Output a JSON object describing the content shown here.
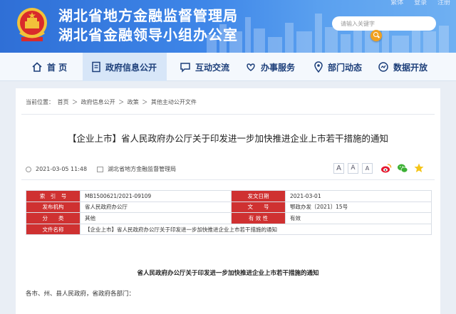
{
  "header": {
    "title_line1": "湖北省地方金融监督管理局",
    "title_line2": "湖北省金融领导小组办公室",
    "top_links": [
      "繁体",
      "登录",
      "注册"
    ],
    "search_placeholder": "请输入关键字"
  },
  "nav": {
    "items": [
      {
        "label": "首 页",
        "icon": "home-icon"
      },
      {
        "label": "政府信息公开",
        "icon": "document-icon"
      },
      {
        "label": "互动交流",
        "icon": "chat-icon"
      },
      {
        "label": "办事服务",
        "icon": "heart-hands-icon"
      },
      {
        "label": "部门动态",
        "icon": "pin-icon"
      },
      {
        "label": "数据开放",
        "icon": "data-icon"
      }
    ],
    "active_index": 1
  },
  "breadcrumb": {
    "prefix": "当前位置：",
    "items": [
      "首页",
      "政府信息公开",
      "政策",
      "其他主动公开文件"
    ],
    "separator": "＞"
  },
  "article": {
    "title": "【企业上市】省人民政府办公厅关于印发进一步加快推进企业上市若干措施的通知",
    "date": "2021-03-05 11:48",
    "source": "湖北省地方金融监督管理局",
    "font_sizes": [
      "A",
      "A",
      "A"
    ],
    "share_icons": [
      "weibo-icon",
      "wechat-icon",
      "favorite-icon"
    ]
  },
  "info_table": {
    "rows": [
      {
        "label1": "索　引　号",
        "value1": "MB1500621/2021-09109",
        "label2": "发文日期",
        "value2": "2021-03-01"
      },
      {
        "label1": "发布机构",
        "value1": "省人民政府办公厅",
        "label2": "文　　号",
        "value2": "鄂政办发〔2021〕15号"
      },
      {
        "label1": "分　　类",
        "value1": "其他",
        "label2": "有 效 性",
        "value2": "有效"
      },
      {
        "label1": "文件名称",
        "value1": "【企业上市】省人民政府办公厅关于印发进一步加快推进企业上市若干措施的通知",
        "label2": "",
        "value2": ""
      }
    ]
  },
  "body": {
    "title": "省人民政府办公厅关于印发进一步加快推进企业上市若干措施的通知",
    "para1": "各市、州、县人民政府，省政府各部门："
  },
  "colors": {
    "header_blue": "#2f6fd6",
    "nav_text": "#1d3f7a",
    "table_label_red": "#cf3131",
    "search_button": "#f0a020"
  }
}
